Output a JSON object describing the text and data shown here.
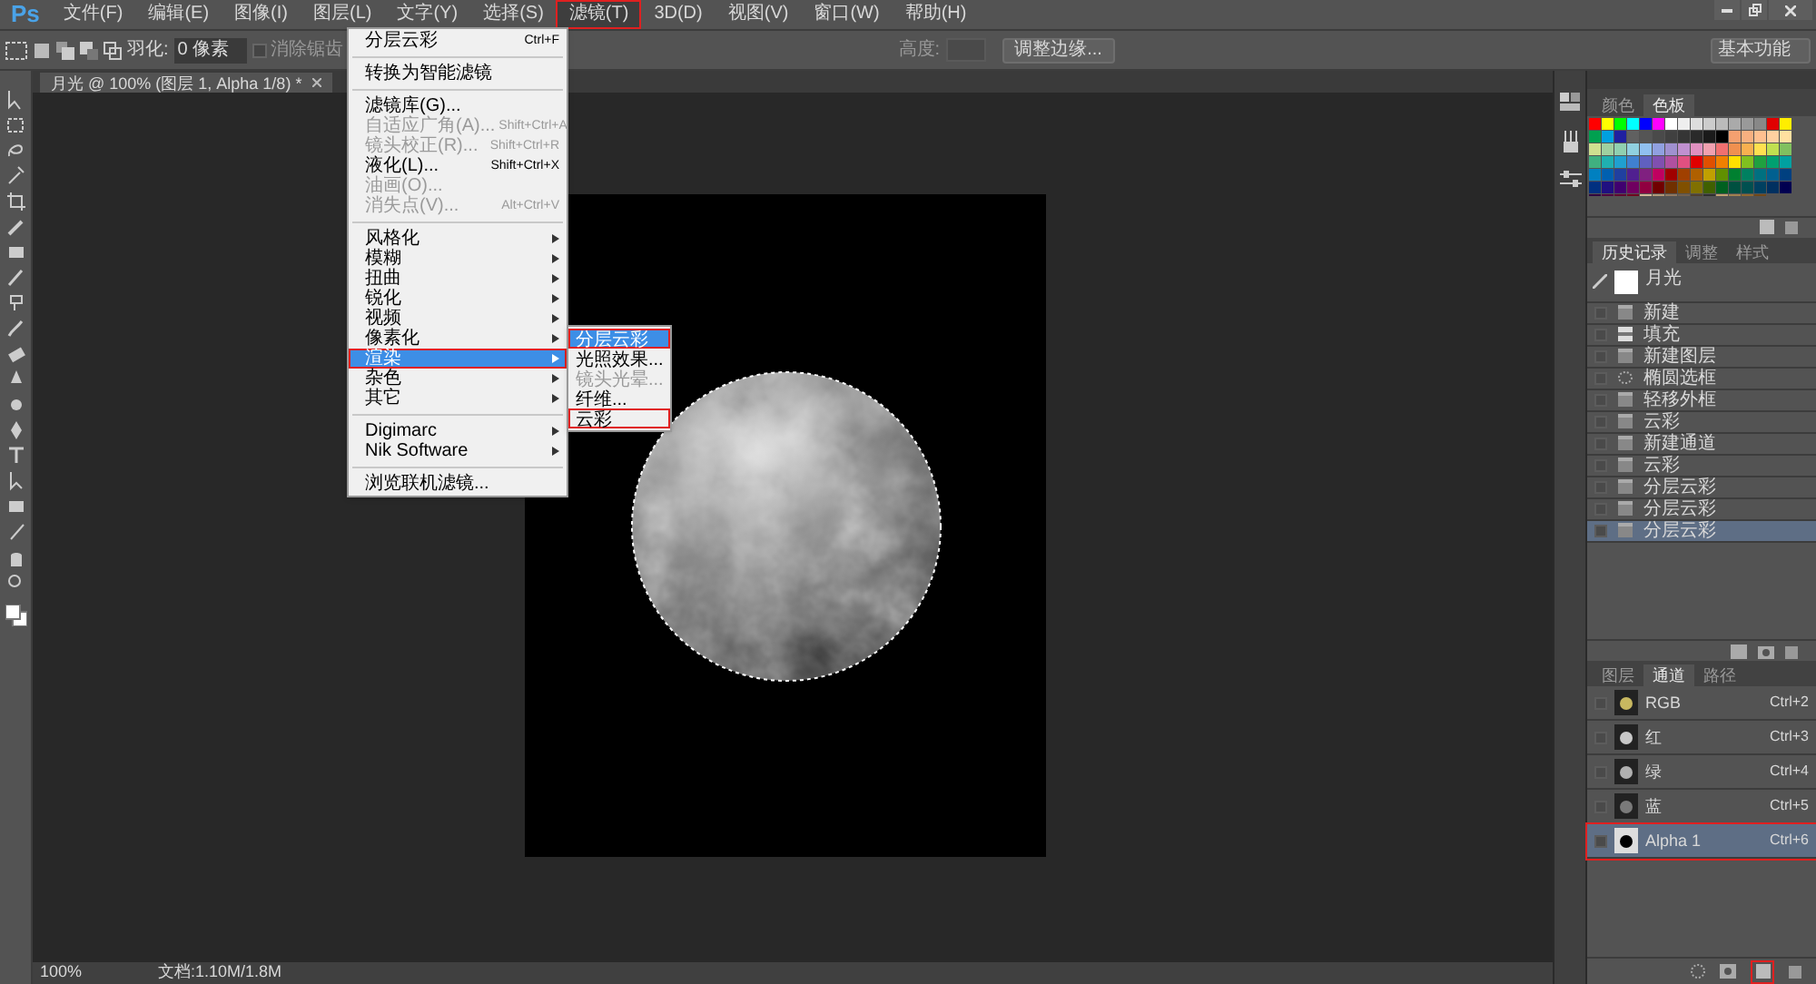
{
  "app": {
    "logo": "Ps"
  },
  "menu_bar": [
    {
      "label": "文件(F)",
      "selected": false,
      "marked": false
    },
    {
      "label": "编辑(E)",
      "selected": false,
      "marked": false
    },
    {
      "label": "图像(I)",
      "selected": false,
      "marked": false
    },
    {
      "label": "图层(L)",
      "selected": false,
      "marked": false
    },
    {
      "label": "文字(Y)",
      "selected": false,
      "marked": false
    },
    {
      "label": "选择(S)",
      "selected": false,
      "marked": false
    },
    {
      "label": "滤镜(T)",
      "selected": true,
      "marked": true
    },
    {
      "label": "3D(D)",
      "selected": false,
      "marked": false
    },
    {
      "label": "视图(V)",
      "selected": false,
      "marked": false
    },
    {
      "label": "窗口(W)",
      "selected": false,
      "marked": false
    },
    {
      "label": "帮助(H)",
      "selected": false,
      "marked": false
    }
  ],
  "options_bar": {
    "feather_label": "羽化:",
    "feather_value": "0 像素",
    "antialias_label": "消除锯齿",
    "antialias_checked": false,
    "height_label": "高度:",
    "refine_button": "调整边缘...",
    "workspace": "基本功能"
  },
  "document_tab": "月光 @ 100% (图层 1, Alpha 1/8) *",
  "filter_menu": [
    {
      "kind": "item",
      "label": "分层云彩",
      "shortcut": "Ctrl+F",
      "disabled": false,
      "selected": false,
      "submenu": false,
      "marked": false
    },
    {
      "kind": "separator"
    },
    {
      "kind": "item",
      "label": "转换为智能滤镜",
      "disabled": false,
      "selected": false,
      "submenu": false,
      "marked": false
    },
    {
      "kind": "separator"
    },
    {
      "kind": "item",
      "label": "滤镜库(G)...",
      "disabled": false,
      "selected": false,
      "submenu": false,
      "marked": false
    },
    {
      "kind": "item",
      "label": "自适应广角(A)...",
      "shortcut": "Shift+Ctrl+A",
      "disabled": true,
      "selected": false,
      "submenu": false,
      "marked": false
    },
    {
      "kind": "item",
      "label": "镜头校正(R)...",
      "shortcut": "Shift+Ctrl+R",
      "disabled": true,
      "selected": false,
      "submenu": false,
      "marked": false
    },
    {
      "kind": "item",
      "label": "液化(L)...",
      "shortcut": "Shift+Ctrl+X",
      "disabled": false,
      "selected": false,
      "submenu": false,
      "marked": false
    },
    {
      "kind": "item",
      "label": "油画(O)...",
      "disabled": true,
      "selected": false,
      "submenu": false,
      "marked": false
    },
    {
      "kind": "item",
      "label": "消失点(V)...",
      "shortcut": "Alt+Ctrl+V",
      "disabled": true,
      "selected": false,
      "submenu": false,
      "marked": false
    },
    {
      "kind": "separator"
    },
    {
      "kind": "item",
      "label": "风格化",
      "disabled": false,
      "selected": false,
      "submenu": true,
      "marked": false
    },
    {
      "kind": "item",
      "label": "模糊",
      "disabled": false,
      "selected": false,
      "submenu": true,
      "marked": false
    },
    {
      "kind": "item",
      "label": "扭曲",
      "disabled": false,
      "selected": false,
      "submenu": true,
      "marked": false
    },
    {
      "kind": "item",
      "label": "锐化",
      "disabled": false,
      "selected": false,
      "submenu": true,
      "marked": false
    },
    {
      "kind": "item",
      "label": "视频",
      "disabled": false,
      "selected": false,
      "submenu": true,
      "marked": false
    },
    {
      "kind": "item",
      "label": "像素化",
      "disabled": false,
      "selected": false,
      "submenu": true,
      "marked": false
    },
    {
      "kind": "item",
      "label": "渲染",
      "disabled": false,
      "selected": true,
      "submenu": true,
      "marked": true
    },
    {
      "kind": "item",
      "label": "杂色",
      "disabled": false,
      "selected": false,
      "submenu": true,
      "marked": false
    },
    {
      "kind": "item",
      "label": "其它",
      "disabled": false,
      "selected": false,
      "submenu": true,
      "marked": false
    },
    {
      "kind": "separator"
    },
    {
      "kind": "item",
      "label": "Digimarc",
      "disabled": false,
      "selected": false,
      "submenu": true,
      "marked": false
    },
    {
      "kind": "item",
      "label": "Nik Software",
      "disabled": false,
      "selected": false,
      "submenu": true,
      "marked": false
    },
    {
      "kind": "separator"
    },
    {
      "kind": "item",
      "label": "浏览联机滤镜...",
      "disabled": false,
      "selected": false,
      "submenu": false,
      "marked": false
    }
  ],
  "render_submenu": [
    {
      "label": "分层云彩",
      "disabled": false,
      "selected": true,
      "marked": true
    },
    {
      "label": "光照效果...",
      "disabled": false,
      "selected": false,
      "marked": false
    },
    {
      "label": "镜头光晕...",
      "disabled": true,
      "selected": false,
      "marked": false
    },
    {
      "label": "纤维...",
      "disabled": false,
      "selected": false,
      "marked": false
    },
    {
      "label": "云彩",
      "disabled": false,
      "selected": false,
      "marked": true
    }
  ],
  "swatches_panel": {
    "tabs": [
      {
        "label": "颜色",
        "selected": false
      },
      {
        "label": "色板",
        "selected": true
      }
    ]
  },
  "history_panel": {
    "tabs": [
      {
        "label": "历史记录",
        "selected": true
      },
      {
        "label": "调整",
        "selected": false
      },
      {
        "label": "样式",
        "selected": false
      }
    ],
    "snapshot": "月光",
    "items": [
      {
        "kind": "doc",
        "label": "新建",
        "selected": false
      },
      {
        "kind": "fill",
        "label": "填充",
        "selected": false
      },
      {
        "kind": "doc",
        "label": "新建图层",
        "selected": false
      },
      {
        "kind": "ellipse",
        "label": "椭圆选框",
        "selected": false
      },
      {
        "kind": "doc",
        "label": "轻移外框",
        "selected": false
      },
      {
        "kind": "doc",
        "label": "云彩",
        "selected": false
      },
      {
        "kind": "doc",
        "label": "新建通道",
        "selected": false
      },
      {
        "kind": "doc",
        "label": "云彩",
        "selected": false
      },
      {
        "kind": "doc",
        "label": "分层云彩",
        "selected": false
      },
      {
        "kind": "doc",
        "label": "分层云彩",
        "selected": false
      },
      {
        "kind": "doc",
        "label": "分层云彩",
        "selected": true
      }
    ]
  },
  "channels_panel": {
    "tabs": [
      {
        "label": "图层",
        "selected": false
      },
      {
        "label": "通道",
        "selected": true
      },
      {
        "label": "路径",
        "selected": false
      }
    ],
    "channels": [
      {
        "label": "RGB",
        "shortcut": "Ctrl+2",
        "selected": false,
        "marked": false,
        "color": "#c8b860"
      },
      {
        "label": "红",
        "shortcut": "Ctrl+3",
        "selected": false,
        "marked": false,
        "color": "#c8c8c8"
      },
      {
        "label": "绿",
        "shortcut": "Ctrl+4",
        "selected": false,
        "marked": false,
        "color": "#b0b0b0"
      },
      {
        "label": "蓝",
        "shortcut": "Ctrl+5",
        "selected": false,
        "marked": false,
        "color": "#7a7a7a"
      },
      {
        "label": "Alpha 1",
        "shortcut": "Ctrl+6",
        "selected": true,
        "marked": true,
        "color": "#000000"
      }
    ],
    "new_channel_marked": true
  },
  "status_bar": {
    "zoom": "100%",
    "doc_info": "文档:1.10M/1.8M"
  }
}
